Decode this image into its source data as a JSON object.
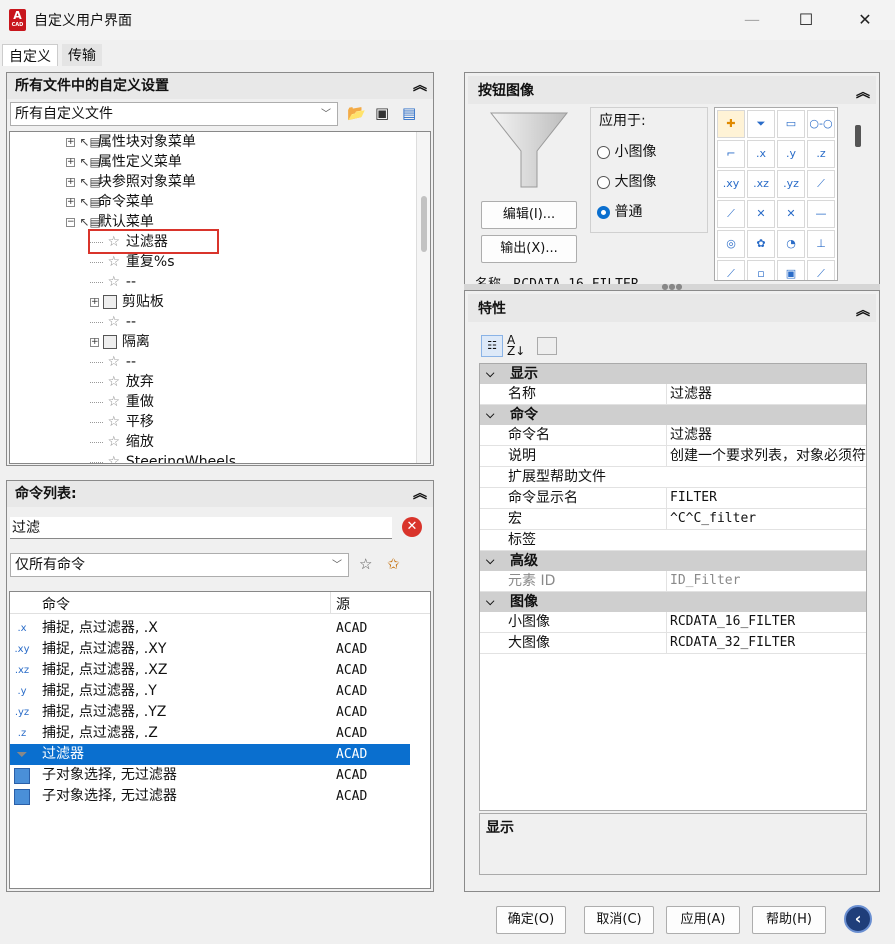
{
  "window": {
    "title": "自定义用户界面",
    "app_icon_letter": "A",
    "app_icon_sub": "CAD"
  },
  "tabs": [
    "自定义",
    "传输"
  ],
  "customizations_panel": {
    "title": "所有文件中的自定义设置",
    "file_select": "所有自定义文件",
    "tree": [
      {
        "label": "属性块对象菜单",
        "level": 1,
        "type": "menu",
        "expander": "+"
      },
      {
        "label": "属性定义菜单",
        "level": 1,
        "type": "menu",
        "expander": "+"
      },
      {
        "label": "块参照对象菜单",
        "level": 1,
        "type": "menu",
        "expander": "+"
      },
      {
        "label": "命令菜单",
        "level": 1,
        "type": "menu",
        "expander": "+"
      },
      {
        "label": "默认菜单",
        "level": 1,
        "type": "menu",
        "expander": "-"
      },
      {
        "label": "过滤器",
        "level": 2,
        "type": "command",
        "expander": ""
      },
      {
        "label": "重复%s",
        "level": 2,
        "type": "command",
        "expander": ""
      },
      {
        "label": "--",
        "level": 2,
        "type": "command",
        "expander": ""
      },
      {
        "label": "剪贴板",
        "level": 2,
        "type": "submenu",
        "expander": "+"
      },
      {
        "label": "--",
        "level": 2,
        "type": "command",
        "expander": ""
      },
      {
        "label": "隔离",
        "level": 2,
        "type": "submenu",
        "expander": "+"
      },
      {
        "label": "--",
        "level": 2,
        "type": "command",
        "expander": ""
      },
      {
        "label": "放弃",
        "level": 2,
        "type": "command",
        "expander": ""
      },
      {
        "label": "重做",
        "level": 2,
        "type": "command",
        "expander": ""
      },
      {
        "label": "平移",
        "level": 2,
        "type": "command",
        "expander": ""
      },
      {
        "label": "缩放",
        "level": 2,
        "type": "command",
        "expander": ""
      },
      {
        "label": "SteeringWheels",
        "level": 2,
        "type": "command",
        "expander": ""
      }
    ]
  },
  "command_list_panel": {
    "title": "命令列表:",
    "search_value": "过滤",
    "filter_select": "仅所有命令",
    "columns": [
      "命令",
      "源"
    ],
    "rows": [
      {
        "icon": ".x",
        "command": "捕捉, 点过滤器, .X",
        "source": "ACAD"
      },
      {
        "icon": ".xy",
        "command": "捕捉, 点过滤器, .XY",
        "source": "ACAD"
      },
      {
        "icon": ".xz",
        "command": "捕捉, 点过滤器, .XZ",
        "source": "ACAD"
      },
      {
        "icon": ".y",
        "command": "捕捉, 点过滤器, .Y",
        "source": "ACAD"
      },
      {
        "icon": ".yz",
        "command": "捕捉, 点过滤器, .YZ",
        "source": "ACAD"
      },
      {
        "icon": ".z",
        "command": "捕捉, 点过滤器, .Z",
        "source": "ACAD"
      },
      {
        "icon": "funnel",
        "command": "过滤器",
        "source": "ACAD"
      },
      {
        "icon": "select",
        "command": "子对象选择, 无过滤器",
        "source": "ACAD"
      },
      {
        "icon": "select",
        "command": "子对象选择, 无过滤器",
        "source": "ACAD"
      }
    ],
    "selected_index": 6
  },
  "button_image_panel": {
    "title": "按钮图像",
    "apply_to_label": "应用于:",
    "options": [
      "小图像",
      "大图像",
      "普通"
    ],
    "selected_option": "普通",
    "edit_button": "编辑(I)...",
    "export_button": "输出(X)...",
    "partial_name_label": "名称",
    "partial_name_value": "RCDATA_16_FILTER",
    "grid_icons": [
      "✚",
      "⏷",
      "▭",
      "○-○",
      "⌐",
      ".x",
      ".y",
      ".z",
      ".xy",
      ".xz",
      ".yz",
      "⟋",
      "⟋",
      "✕",
      "✕",
      "—",
      "◎",
      "✿",
      "◔",
      "⊥",
      "⟋",
      "▫",
      "▣",
      "⟋"
    ]
  },
  "properties_panel": {
    "title": "特性",
    "categories": [
      {
        "name": "显示",
        "rows": [
          {
            "name": "名称",
            "value": "过滤器"
          }
        ]
      },
      {
        "name": "命令",
        "rows": [
          {
            "name": "命令名",
            "value": "过滤器"
          },
          {
            "name": "说明",
            "value": "创建一个要求列表，对象必须符"
          },
          {
            "name": "扩展型帮助文件",
            "value": ""
          },
          {
            "name": "命令显示名",
            "value": "FILTER"
          },
          {
            "name": "宏",
            "value": "^C^C_filter"
          },
          {
            "name": "标签",
            "value": ""
          }
        ]
      },
      {
        "name": "高级",
        "rows": [
          {
            "name": "元素 ID",
            "value": "ID_Filter",
            "disabled": true
          }
        ]
      },
      {
        "name": "图像",
        "rows": [
          {
            "name": "小图像",
            "value": "RCDATA_16_FILTER"
          },
          {
            "name": "大图像",
            "value": "RCDATA_32_FILTER"
          }
        ]
      }
    ],
    "description_title": "显示"
  },
  "footer": {
    "ok": "确定(O)",
    "cancel": "取消(C)",
    "apply": "应用(A)",
    "help": "帮助(H)"
  },
  "colors": {
    "selection": "#0a6fcf",
    "highlight_box": "#d9342b",
    "category_bg": "#cfcfcf"
  }
}
